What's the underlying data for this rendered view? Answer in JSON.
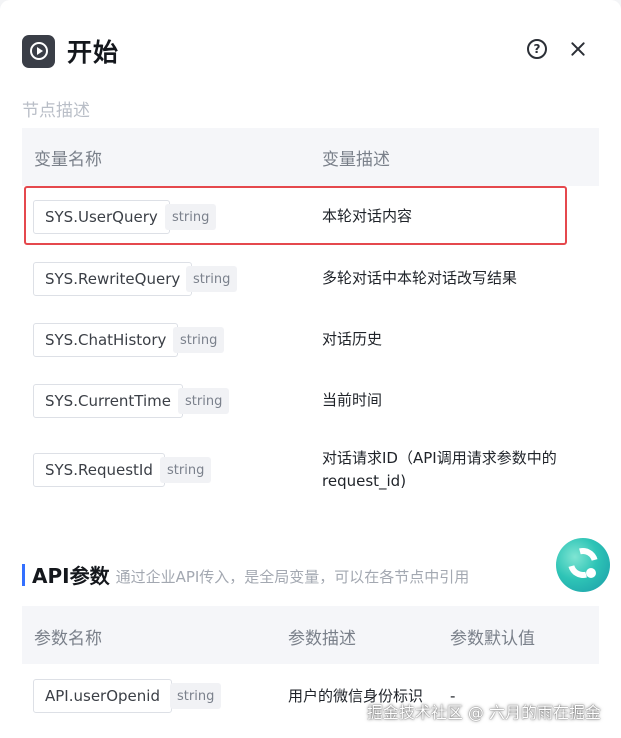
{
  "header": {
    "title": "开始"
  },
  "section": {
    "label": "节点描述"
  },
  "table": {
    "col_name": "变量名称",
    "col_desc": "变量描述",
    "rows": [
      {
        "name": "SYS.UserQuery",
        "type": "string",
        "desc": "本轮对话内容"
      },
      {
        "name": "SYS.RewriteQuery",
        "type": "string",
        "desc": "多轮对话中本轮对话改写结果"
      },
      {
        "name": "SYS.ChatHistory",
        "type": "string",
        "desc": "对话历史"
      },
      {
        "name": "SYS.CurrentTime",
        "type": "string",
        "desc": "当前时间"
      },
      {
        "name": "SYS.RequestId",
        "type": "string",
        "desc": "对话请求ID（API调用请求参数中的request_id)"
      }
    ]
  },
  "api": {
    "title": "API参数",
    "subtitle": "通过企业API传入，是全局变量，可以在各节点中引用",
    "col_name": "参数名称",
    "col_desc": "参数描述",
    "col_default": "参数默认值",
    "rows": [
      {
        "name": "API.userOpenid",
        "type": "string",
        "desc": "用户的微信身份标识",
        "default": "-"
      }
    ]
  },
  "watermark": "掘金技术社区 @ 六月的雨在掘金",
  "colors": {
    "accent": "#3370ff",
    "highlight": "#e5484d",
    "header_icon_bg": "#3a3e47"
  }
}
